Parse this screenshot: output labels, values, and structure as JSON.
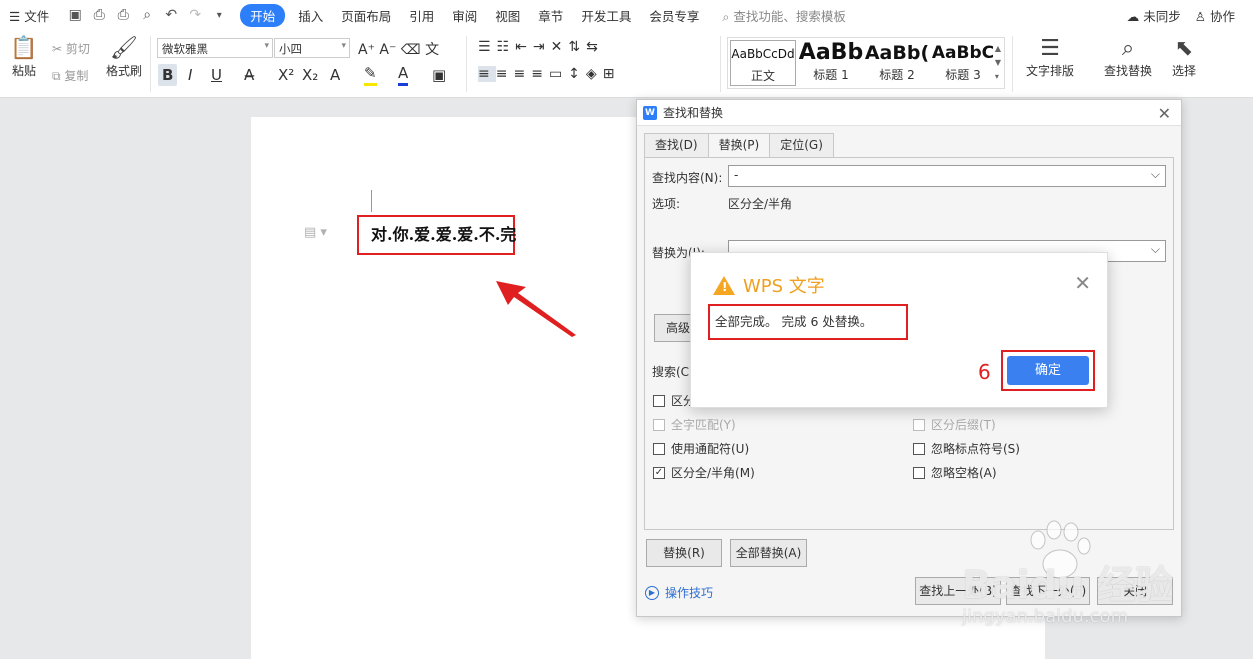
{
  "menubar": {
    "file_label": "文件",
    "tabs": [
      "开始",
      "插入",
      "页面布局",
      "引用",
      "审阅",
      "视图",
      "章节",
      "开发工具",
      "会员专享"
    ],
    "search_label": "查找功能、搜索模板",
    "sync_label": "未同步",
    "collab_label": "协作"
  },
  "ribbon": {
    "paste": "粘贴",
    "cut": "剪切",
    "copy": "复制",
    "format_painter": "格式刷",
    "font_name": "微软雅黑",
    "font_size": "小四",
    "styles": [
      {
        "preview": "AaBbCcDd",
        "name": "正文"
      },
      {
        "preview": "AaBb",
        "name": "标题 1"
      },
      {
        "preview": "AaBb(",
        "name": "标题 2"
      },
      {
        "preview": "AaBbC",
        "name": "标题 3"
      }
    ],
    "text_layout": "文字排版",
    "find_replace": "查找替换",
    "select": "选择"
  },
  "document": {
    "text": "对.你.爱.爱.爱.不.完"
  },
  "find_dialog": {
    "title": "查找和替换",
    "tabs": [
      "查找(D)",
      "替换(P)",
      "定位(G)"
    ],
    "find_label": "查找内容(N):",
    "find_value": "-",
    "options_label": "选项:",
    "options_value": "区分全/半角",
    "replace_label": "替换为(I):",
    "replace_value": "",
    "advanced_button": "高级搜",
    "search_label": "搜索(C",
    "checkboxes": [
      {
        "label": "区分",
        "checked": false,
        "disabled": false
      },
      {
        "label": "全字匹配(Y)",
        "checked": false,
        "disabled": true
      },
      {
        "label": "使用通配符(U)",
        "checked": false,
        "disabled": false
      },
      {
        "label": "区分全/半角(M)",
        "checked": true,
        "disabled": false
      },
      {
        "label": "区分后缀(T)",
        "checked": false,
        "disabled": true
      },
      {
        "label": "忽略标点符号(S)",
        "checked": false,
        "disabled": false
      },
      {
        "label": "忽略空格(A)",
        "checked": false,
        "disabled": false
      }
    ],
    "replace_button": "替换(R)",
    "replace_all_button": "全部替换(A)",
    "tips": "操作技巧",
    "find_prev": "查找上一处(B)",
    "find_next": "查找下一处(F)",
    "close": "关闭"
  },
  "wps_dialog": {
    "title": "WPS 文字",
    "message": "全部完成。 完成 6 处替换。",
    "ok_button": "确定",
    "step_number": "6"
  },
  "watermark": {
    "brand": "Baidu 经验",
    "url": "jingyan.baidu.com"
  },
  "colors": {
    "accent": "#2d7ff9",
    "highlight_red": "#e02020",
    "warning": "#f5a623"
  }
}
